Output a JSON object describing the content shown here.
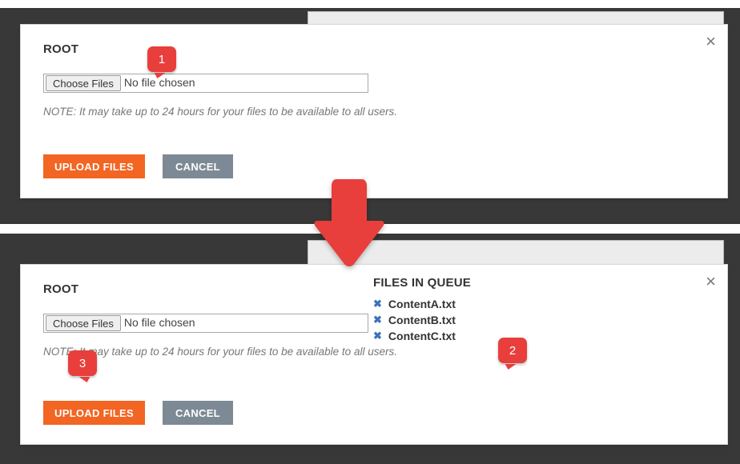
{
  "upper": {
    "title": "ROOT",
    "choose_btn": "Choose Files",
    "file_status": "No file chosen",
    "note": "NOTE: It may take up to 24 hours for your files to be available to all users.",
    "upload_btn": "UPLOAD FILES",
    "cancel_btn": "CANCEL",
    "close_glyph": "×"
  },
  "lower": {
    "title": "ROOT",
    "choose_btn": "Choose Files",
    "file_status": "No file chosen",
    "note": "NOTE: It may take up to 24 hours for your files to be available to all users.",
    "upload_btn": "UPLOAD FILES",
    "cancel_btn": "CANCEL",
    "close_glyph": "×",
    "queue_title": "FILES IN QUEUE",
    "queue_items": {
      "0": {
        "name": "ContentA.txt",
        "remove_glyph": "✖"
      },
      "1": {
        "name": "ContentB.txt",
        "remove_glyph": "✖"
      },
      "2": {
        "name": "ContentC.txt",
        "remove_glyph": "✖"
      }
    }
  },
  "callouts": {
    "c1": "1",
    "c2": "2",
    "c3": "3"
  }
}
